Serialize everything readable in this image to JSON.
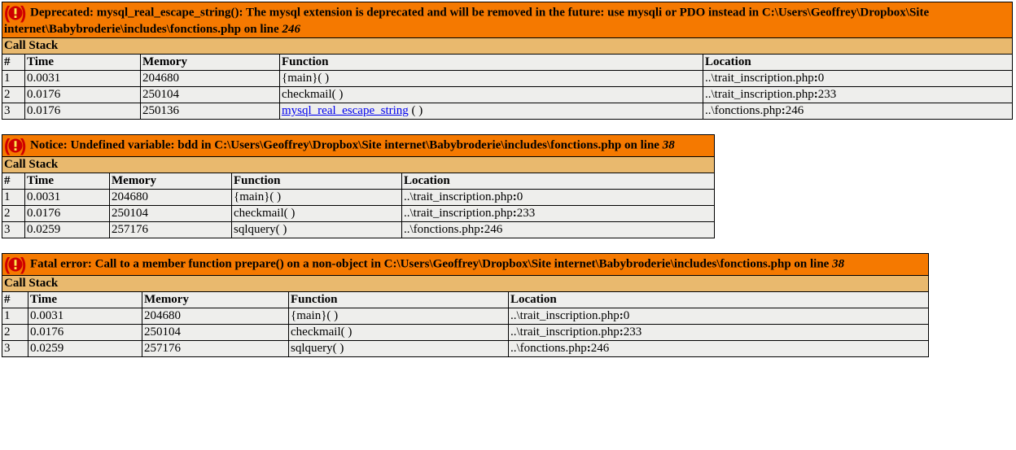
{
  "labels": {
    "call_stack": "Call Stack",
    "num": "#",
    "time": "Time",
    "memory": "Memory",
    "function": "Function",
    "location": "Location"
  },
  "blocks": [
    {
      "title_prefix": "Deprecated: mysql_real_escape_string(): The mysql extension is deprecated and will be removed in the future: use mysqli or PDO instead in C:\\Users\\Geoffrey\\Dropbox\\Site internet\\Babybroderie\\includes\\fonctions.php on line ",
      "title_line": "246",
      "widths": {
        "num": 28,
        "time": 142,
        "mem": 171,
        "func": 520,
        "loc": 380
      },
      "rows": [
        {
          "num": "1",
          "time": "0.0031",
          "mem": "204680",
          "func": "{main}( )",
          "loc_pre": "..\\trait_inscription.php",
          "loc_bold": ":",
          "loc_post": "0",
          "link": false
        },
        {
          "num": "2",
          "time": "0.0176",
          "mem": "250104",
          "func": "checkmail( )",
          "loc_pre": "..\\trait_inscription.php",
          "loc_bold": ":",
          "loc_post": "233",
          "link": false
        },
        {
          "num": "3",
          "time": "0.0176",
          "mem": "250136",
          "func": "mysql_real_escape_string",
          "func_rest": " ( )",
          "loc_pre": "..\\fonctions.php",
          "loc_bold": ":",
          "loc_post": "246",
          "link": true
        }
      ]
    },
    {
      "title_prefix": "Notice: Undefined variable: bdd in C:\\Users\\Geoffrey\\Dropbox\\Site internet\\Babybroderie\\includes\\fonctions.php on line ",
      "title_line": "38",
      "widths": {
        "num": 28,
        "time": 104,
        "mem": 150,
        "func": 209,
        "loc": 384
      },
      "rows": [
        {
          "num": "1",
          "time": "0.0031",
          "mem": "204680",
          "func": "{main}( )",
          "loc_pre": "..\\trait_inscription.php",
          "loc_bold": ":",
          "loc_post": "0",
          "link": false
        },
        {
          "num": "2",
          "time": "0.0176",
          "mem": "250104",
          "func": "checkmail( )",
          "loc_pre": "..\\trait_inscription.php",
          "loc_bold": ":",
          "loc_post": "233",
          "link": false
        },
        {
          "num": "3",
          "time": "0.0259",
          "mem": "257176",
          "func": "sqlquery( )",
          "loc_pre": "..\\fonctions.php",
          "loc_bold": ":",
          "loc_post": "246",
          "link": false
        }
      ]
    },
    {
      "title_prefix": "Fatal error: Call to a member function prepare() on a non-object in C:\\Users\\Geoffrey\\Dropbox\\Site internet\\Babybroderie\\includes\\fonctions.php on line ",
      "title_line": "38",
      "widths": {
        "num": 32,
        "time": 140,
        "mem": 180,
        "func": 270,
        "loc": 516
      },
      "rows": [
        {
          "num": "1",
          "time": "0.0031",
          "mem": "204680",
          "func": "{main}( )",
          "loc_pre": "..\\trait_inscription.php",
          "loc_bold": ":",
          "loc_post": "0",
          "link": false
        },
        {
          "num": "2",
          "time": "0.0176",
          "mem": "250104",
          "func": "checkmail( )",
          "loc_pre": "..\\trait_inscription.php",
          "loc_bold": ":",
          "loc_post": "233",
          "link": false
        },
        {
          "num": "3",
          "time": "0.0259",
          "mem": "257176",
          "func": "sqlquery( )",
          "loc_pre": "..\\fonctions.php",
          "loc_bold": ":",
          "loc_post": "246",
          "link": false
        }
      ]
    }
  ]
}
